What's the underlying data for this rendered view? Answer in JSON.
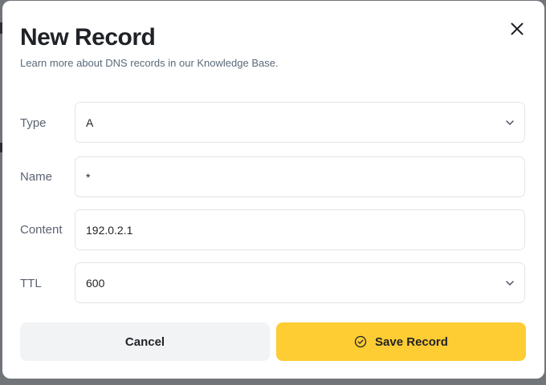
{
  "dialog": {
    "title": "New Record",
    "subtitle": "Learn more about DNS records in our Knowledge Base.",
    "close_icon": "close-icon"
  },
  "form": {
    "type": {
      "label": "Type",
      "value": "A",
      "control": "select",
      "icon": "chevron-down-icon"
    },
    "name": {
      "label": "Name",
      "value": "*",
      "control": "input"
    },
    "content": {
      "label": "Content",
      "value": "192.0.2.1",
      "control": "input"
    },
    "ttl": {
      "label": "TTL",
      "value": "600",
      "control": "select",
      "icon": "chevron-down-icon"
    }
  },
  "actions": {
    "cancel_label": "Cancel",
    "save_label": "Save Record",
    "save_icon": "check-circle-icon"
  },
  "colors": {
    "primary_button": "#fecc33",
    "secondary_button": "#f2f3f5",
    "text": "#1f2226",
    "muted_text": "#5a6a7a"
  }
}
